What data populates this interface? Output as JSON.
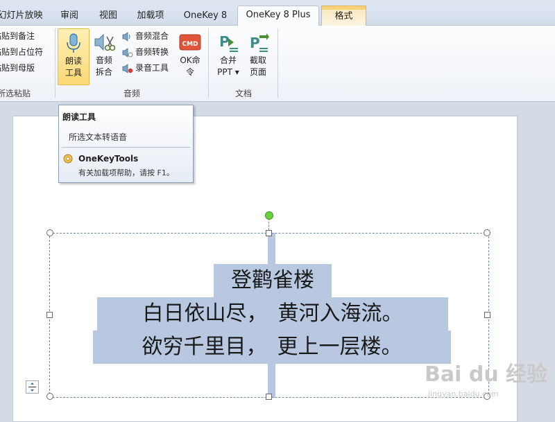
{
  "tabs": [
    {
      "label": "幻灯片放映"
    },
    {
      "label": "审阅"
    },
    {
      "label": "视图"
    },
    {
      "label": "加载项"
    },
    {
      "label": "OneKey 8"
    },
    {
      "label": "OneKey 8 Plus"
    },
    {
      "label": "格式"
    }
  ],
  "ribbon": {
    "paste_group": {
      "items": [
        "粘贴到备注",
        "粘贴到占位符",
        "粘贴到母版"
      ],
      "label": "所选粘贴"
    },
    "audio_group": {
      "read_button": [
        "朗读",
        "工具"
      ],
      "split_button": [
        "音频",
        "拆合"
      ],
      "small_items": [
        "音频混合",
        "音频转换",
        "录音工具"
      ],
      "cmd_button": [
        "OK命",
        "令"
      ],
      "cmd_icon_text": "CMD",
      "label": "音频"
    },
    "doc_group": {
      "merge_button": [
        "合并",
        "PPT ▾"
      ],
      "capture_button": [
        "截取",
        "页面"
      ],
      "label": "文档"
    }
  },
  "tooltip": {
    "title": "朗读工具",
    "description": "所选文本转语音",
    "addin_name": "OneKeyTools",
    "help": "有关加载项帮助，请按 F1。"
  },
  "poem": {
    "title": "登鹳雀楼",
    "line1": "白日依山尽，　黄河入海流。",
    "line2": "欲穷千里目，　更上一层楼。"
  },
  "watermark": {
    "brand": "Bai du 经验",
    "url": "jingyan.baidu.com"
  },
  "colors": {
    "tab_active_border": "#b6c3d6",
    "format_tab": "#f6d27a",
    "highlight": "#b8c8e0",
    "button_pressed": "#fcd876",
    "rotate_handle": "#6ecf3f"
  },
  "icons": {
    "microphone": "microphone-icon",
    "scissors": "scissors-icon",
    "speaker": "speaker-icon",
    "cmd": "cmd-icon",
    "merge": "merge-ppt-icon",
    "capture": "capture-page-icon",
    "gear": "gear-icon"
  }
}
